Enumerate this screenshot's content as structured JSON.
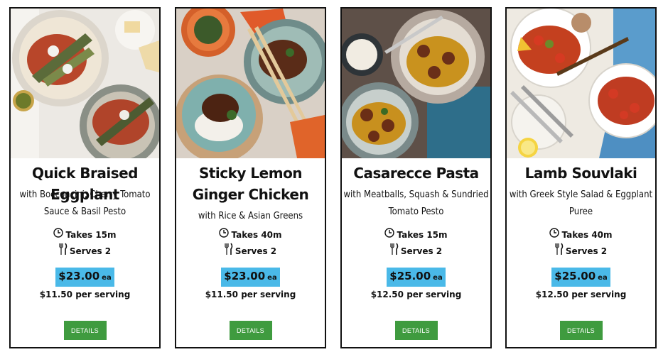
{
  "cards": [
    {
      "title": "Quick Braised Eggplant",
      "subtitle": "with Bocconcini, Cherry Tomato Sauce & Basil Pesto",
      "time": "Takes 15m",
      "serves": "Serves 2",
      "price": "$23.00",
      "price_unit": "ea",
      "per_serving": "$11.50 per serving",
      "button": "DETAILS"
    },
    {
      "title": "Sticky Lemon Ginger Chicken",
      "subtitle": "with Rice & Asian Greens",
      "time": "Takes 40m",
      "serves": "Serves 2",
      "price": "$23.00",
      "price_unit": "ea",
      "per_serving": "$11.50 per serving",
      "button": "DETAILS"
    },
    {
      "title": "Casarecce Pasta",
      "subtitle": "with Meatballs, Squash & Sundried Tomato Pesto",
      "time": "Takes 15m",
      "serves": "Serves 2",
      "price": "$25.00",
      "price_unit": "ea",
      "per_serving": "$12.50 per serving",
      "button": "DETAILS"
    },
    {
      "title": "Lamb Souvlaki",
      "subtitle": "with Greek Style Salad & Eggplant Puree",
      "time": "Takes 40m",
      "serves": "Serves 2",
      "price": "$25.00",
      "price_unit": "ea",
      "per_serving": "$12.50 per serving",
      "button": "DETAILS"
    }
  ],
  "colors": {
    "price_highlight": "#4ab9e8",
    "button": "#3f9b3f",
    "border": "#111111"
  },
  "icons": [
    "clock-icon",
    "fork-knife-icon"
  ]
}
